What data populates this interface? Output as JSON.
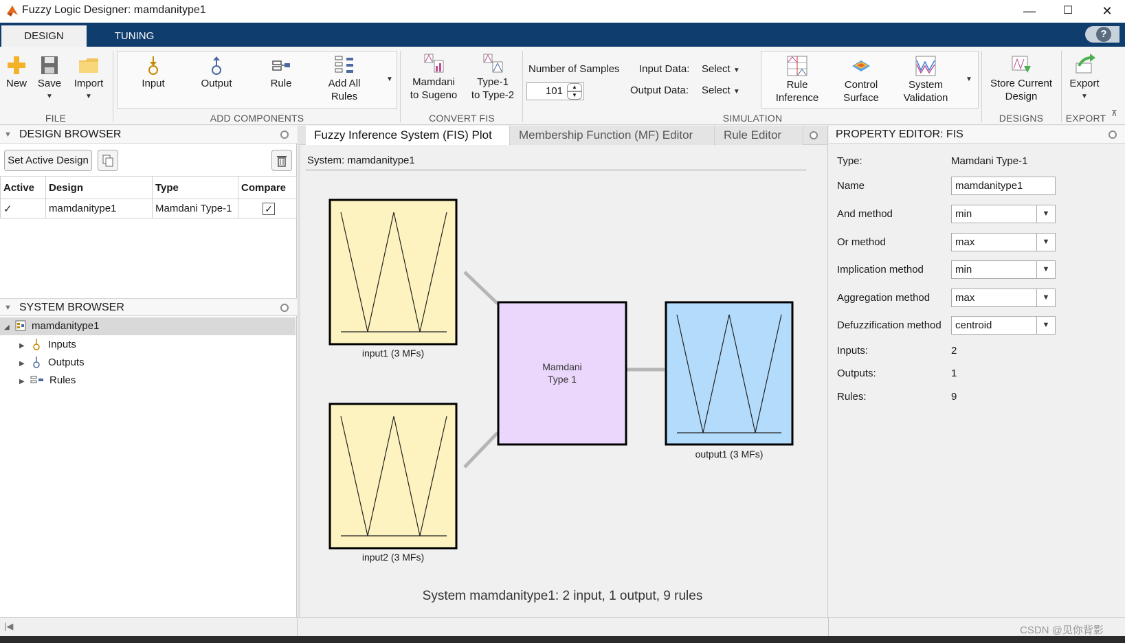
{
  "window": {
    "title": "Fuzzy Logic Designer: mamdanitype1",
    "minimize": "—",
    "maximize": "☐",
    "close": "✕"
  },
  "tabs": {
    "design": "DESIGN",
    "tuning": "TUNING",
    "help": "?"
  },
  "ribbon": {
    "file": {
      "new": "New",
      "save": "Save",
      "import": "Import",
      "group": "FILE"
    },
    "add_components": {
      "input": "Input",
      "output": "Output",
      "rule": "Rule",
      "add_all_1": "Add All",
      "add_all_2": "Rules",
      "group": "ADD COMPONENTS"
    },
    "convert_fis": {
      "m2s_1": "Mamdani",
      "m2s_2": "to Sugeno",
      "t1_1": "Type-1",
      "t1_2": "to Type-2",
      "group": "CONVERT FIS"
    },
    "simulation": {
      "num_samples_label": "Number of Samples",
      "num_samples_value": "101",
      "input_data_label": "Input Data:",
      "input_data_value": "Select",
      "output_data_label": "Output Data:",
      "output_data_value": "Select",
      "rule_inf_1": "Rule",
      "rule_inf_2": "Inference",
      "ctrl_1": "Control",
      "ctrl_2": "Surface",
      "sysval_1": "System",
      "sysval_2": "Validation",
      "group": "SIMULATION"
    },
    "designs": {
      "store_1": "Store Current",
      "store_2": "Design",
      "group": "DESIGNS"
    },
    "export": {
      "label": "Export",
      "group": "EXPORT"
    }
  },
  "design_browser": {
    "title": "DESIGN BROWSER",
    "set_active": "Set Active Design",
    "columns": [
      "Active",
      "Design",
      "Type",
      "Compare"
    ],
    "rows": [
      {
        "active": "✓",
        "design": "mamdanitype1",
        "type": "Mamdani Type-1",
        "compare": true
      }
    ]
  },
  "system_browser": {
    "title": "SYSTEM BROWSER",
    "root": "mamdanitype1",
    "children": [
      "Inputs",
      "Outputs",
      "Rules"
    ]
  },
  "center": {
    "tabs": [
      "Fuzzy Inference System (FIS) Plot",
      "Membership Function (MF) Editor",
      "Rule Editor"
    ],
    "system_label": "System: mamdanitype1",
    "input1_label": "input1 (3 MFs)",
    "input2_label": "input2 (3 MFs)",
    "output1_label": "output1 (3 MFs)",
    "engine_line1": "Mamdani",
    "engine_line2": "Type 1",
    "summary": "System mamdanitype1: 2 input, 1 output, 9 rules",
    "colors": {
      "input": "#fdf3c0",
      "engine": "#ead7fb",
      "output": "#b3dcfc"
    }
  },
  "property_editor": {
    "title": "PROPERTY EDITOR: FIS",
    "type_label": "Type:",
    "type_value": "Mamdani Type-1",
    "name_label": "Name",
    "name_value": "mamdanitype1",
    "and_label": "And method",
    "and_value": "min",
    "or_label": "Or method",
    "or_value": "max",
    "imp_label": "Implication method",
    "imp_value": "min",
    "agg_label": "Aggregation method",
    "agg_value": "max",
    "defuzz_label": "Defuzzification method",
    "defuzz_value": "centroid",
    "inputs_label": "Inputs:",
    "inputs_value": "2",
    "outputs_label": "Outputs:",
    "outputs_value": "1",
    "rules_label": "Rules:",
    "rules_value": "9"
  },
  "watermark": "CSDN @见你背影"
}
